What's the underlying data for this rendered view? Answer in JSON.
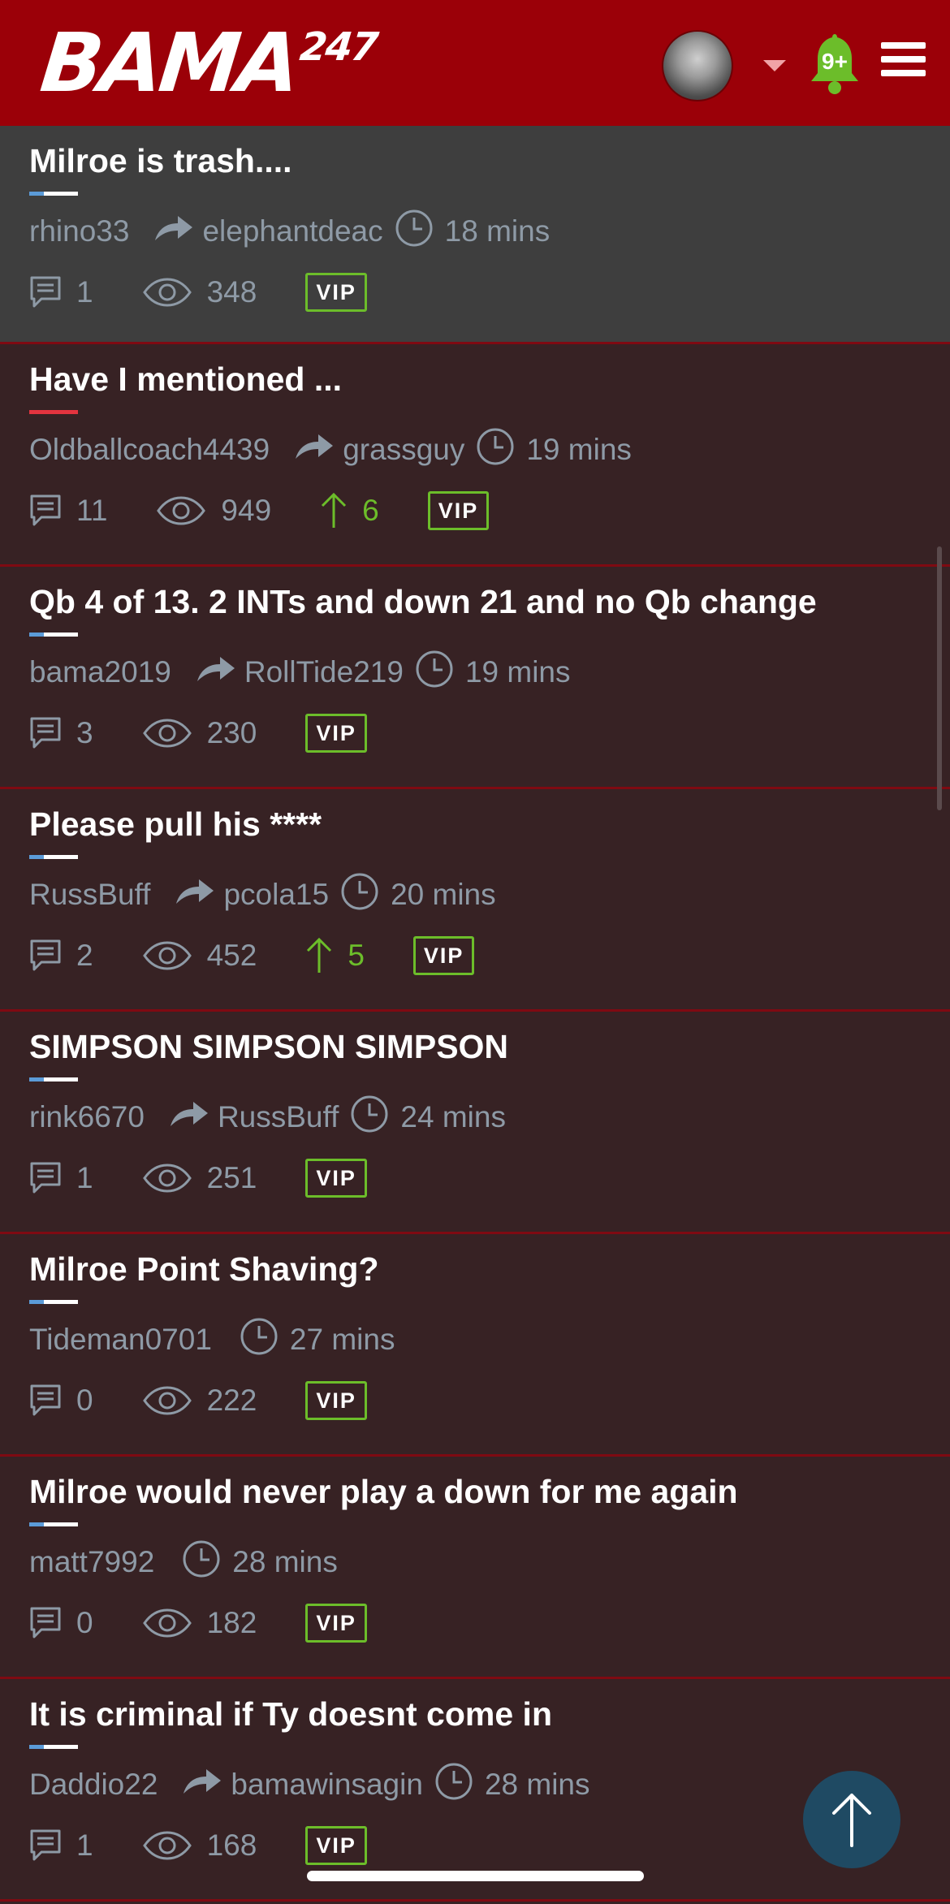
{
  "header": {
    "logo_text": "BAMA",
    "logo_super": "247",
    "notification_count": "9+",
    "colors": {
      "bar": "#9b0008",
      "bell": "#6cbd2a"
    }
  },
  "threads": [
    {
      "title": "Milroe is trash....",
      "author": "rhino33",
      "last_reply": "elephantdeac",
      "time": "18 mins",
      "replies": "1",
      "views": "348",
      "upvotes": "",
      "badge": "VIP",
      "highlighted": true
    },
    {
      "title": "Have I mentioned ...",
      "author": "Oldballcoach4439",
      "last_reply": "grassguy",
      "time": "19 mins",
      "replies": "11",
      "views": "949",
      "upvotes": "6",
      "badge": "VIP"
    },
    {
      "title": "Qb 4 of 13. 2 INTs and down 21 and no Qb change",
      "author": "bama2019",
      "last_reply": "RollTide219",
      "time": "19 mins",
      "replies": "3",
      "views": "230",
      "upvotes": "",
      "badge": "VIP"
    },
    {
      "title": "Please pull his ****",
      "author": "RussBuff",
      "last_reply": "pcola15",
      "time": "20 mins",
      "replies": "2",
      "views": "452",
      "upvotes": "5",
      "badge": "VIP"
    },
    {
      "title": "SIMPSON SIMPSON SIMPSON",
      "author": "rink6670",
      "last_reply": "RussBuff",
      "time": "24 mins",
      "replies": "1",
      "views": "251",
      "upvotes": "",
      "badge": "VIP"
    },
    {
      "title": "Milroe Point Shaving?",
      "author": "Tideman0701",
      "last_reply": "",
      "time": "27 mins",
      "replies": "0",
      "views": "222",
      "upvotes": "",
      "badge": "VIP"
    },
    {
      "title": "Milroe would never play a down for me again",
      "author": "matt7992",
      "last_reply": "",
      "time": "28 mins",
      "replies": "0",
      "views": "182",
      "upvotes": "",
      "badge": "VIP"
    },
    {
      "title": "It is criminal if Ty doesnt come in",
      "author": "Daddio22",
      "last_reply": "bamawinsagin",
      "time": "28 mins",
      "replies": "1",
      "views": "168",
      "upvotes": "",
      "badge": "VIP"
    }
  ]
}
